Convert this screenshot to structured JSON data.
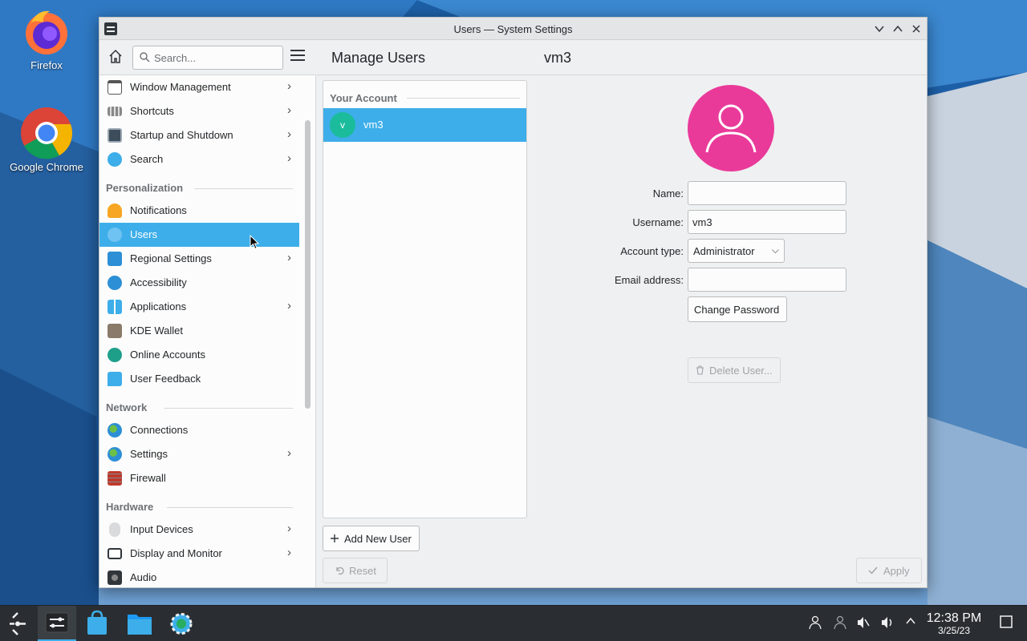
{
  "desktop": {
    "icons": [
      {
        "label": "Firefox"
      },
      {
        "label": "Google Chrome"
      }
    ]
  },
  "window": {
    "title": "Users — System Settings",
    "controls": {
      "minimize": "﹀",
      "maximize": "︿",
      "close": "✕"
    }
  },
  "toolbar": {
    "search_placeholder": "Search...",
    "page_title": "Manage Users",
    "page_subtitle": "vm3"
  },
  "sidebar": {
    "items_top": [
      {
        "label": "Window Management",
        "chevron": true
      },
      {
        "label": "Shortcuts",
        "chevron": true
      },
      {
        "label": "Startup and Shutdown",
        "chevron": true
      },
      {
        "label": "Search",
        "chevron": true
      }
    ],
    "sections": [
      {
        "header": "Personalization",
        "items": [
          {
            "label": "Notifications"
          },
          {
            "label": "Users",
            "selected": true
          },
          {
            "label": "Regional Settings",
            "chevron": true
          },
          {
            "label": "Accessibility"
          },
          {
            "label": "Applications",
            "chevron": true
          },
          {
            "label": "KDE Wallet"
          },
          {
            "label": "Online Accounts"
          },
          {
            "label": "User Feedback"
          }
        ]
      },
      {
        "header": "Network",
        "items": [
          {
            "label": "Connections"
          },
          {
            "label": "Settings",
            "chevron": true
          },
          {
            "label": "Firewall"
          }
        ]
      },
      {
        "header": "Hardware",
        "items": [
          {
            "label": "Input Devices",
            "chevron": true
          },
          {
            "label": "Display and Monitor",
            "chevron": true
          },
          {
            "label": "Audio"
          }
        ]
      }
    ]
  },
  "userlist": {
    "header": "Your Account",
    "users": [
      {
        "initial": "v",
        "name": "vm3"
      }
    ],
    "add_button": "Add New User",
    "reset_button": "Reset"
  },
  "form": {
    "name_label": "Name:",
    "name_value": "",
    "username_label": "Username:",
    "username_value": "vm3",
    "account_type_label": "Account type:",
    "account_type_value": "Administrator",
    "email_label": "Email address:",
    "email_value": "",
    "change_password": "Change Password",
    "delete_user": "Delete User...",
    "apply": "Apply"
  },
  "taskbar": {
    "time": "12:38 PM",
    "date": "3/25/23"
  },
  "colors": {
    "accent": "#3daee9",
    "avatar_large": "#e93a9a",
    "avatar_small": "#1abc9c"
  }
}
